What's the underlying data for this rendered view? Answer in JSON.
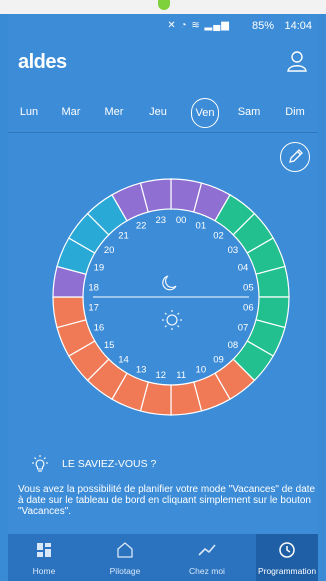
{
  "statusbar": {
    "battery": "85%",
    "time": "14:04"
  },
  "header": {
    "logo": "aldes"
  },
  "days": [
    {
      "label": "Lun",
      "active": false
    },
    {
      "label": "Mar",
      "active": false
    },
    {
      "label": "Mer",
      "active": false
    },
    {
      "label": "Jeu",
      "active": false
    },
    {
      "label": "Ven",
      "active": true
    },
    {
      "label": "Sam",
      "active": false
    },
    {
      "label": "Dim",
      "active": false
    }
  ],
  "clock": {
    "hours": [
      "00",
      "01",
      "02",
      "03",
      "04",
      "05",
      "06",
      "07",
      "08",
      "09",
      "10",
      "11",
      "12",
      "13",
      "14",
      "15",
      "16",
      "17",
      "18",
      "19",
      "20",
      "21",
      "22",
      "23"
    ],
    "segment_colors": [
      "#8f6fd1",
      "#8f6fd1",
      "#21c08e",
      "#21c08e",
      "#21c08e",
      "#21c08e",
      "#21c08e",
      "#21c08e",
      "#21c08e",
      "#f07a56",
      "#f07a56",
      "#f07a56",
      "#f07a56",
      "#f07a56",
      "#f07a56",
      "#f07a56",
      "#f07a56",
      "#f07a56",
      "#8f6fd1",
      "#28a9d6",
      "#28a9d6",
      "#28a9d6",
      "#8f6fd1",
      "#8f6fd1"
    ],
    "night_icon": "moon-icon",
    "day_icon": "sun-icon"
  },
  "tip": {
    "title": "LE SAVIEZ-VOUS ?",
    "text": "Vous avez la possibilité de planifier votre mode \"Vacances\" de date à date sur le tableau de bord en cliquant simplement sur le bouton \"Vacances\"."
  },
  "tabs": [
    {
      "label": "Home",
      "icon": "grid-icon",
      "active": false
    },
    {
      "label": "Pilotage",
      "icon": "house-icon",
      "active": false
    },
    {
      "label": "Chez moi",
      "icon": "trend-icon",
      "active": false
    },
    {
      "label": "Programmation",
      "icon": "clock-icon",
      "active": true
    }
  ]
}
